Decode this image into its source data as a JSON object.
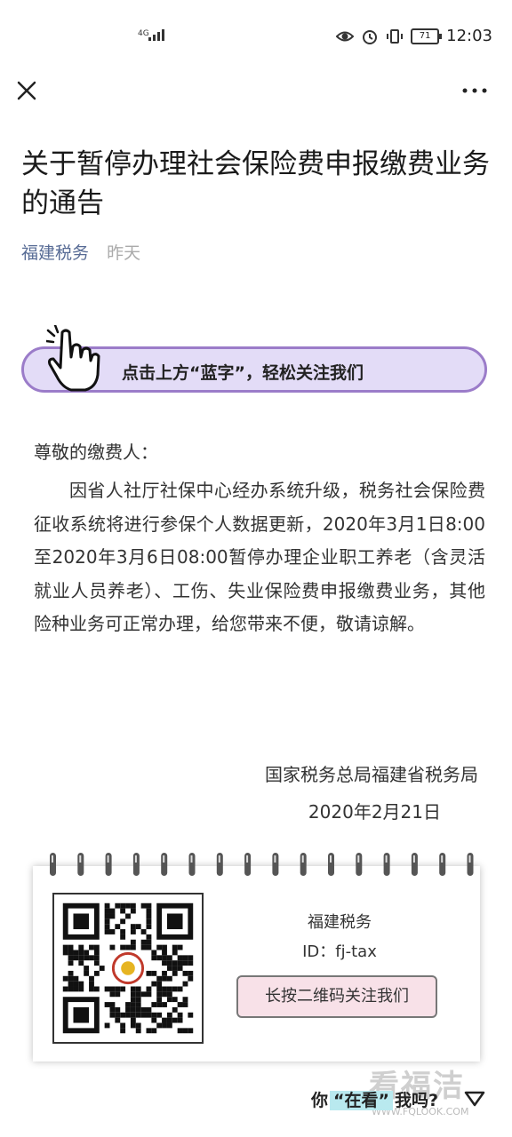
{
  "status_bar": {
    "network": "4G",
    "battery": "71",
    "time": "12:03"
  },
  "article": {
    "title": "关于暂停办理社会保险费申报缴费业务的通告",
    "account": "福建税务",
    "date": "昨天",
    "banner": "点击上方“蓝字”，轻松关注我们",
    "greeting": "尊敬的缴费人：",
    "body": "因省人社厅社保中心经办系统升级，税务社会保险费征收系统将进行参保个人数据更新，2020年3月1日8:00至2020年3月6日08:00暂停办理企业职工养老（含灵活就业人员养老）、工伤、失业保险费申报缴费业务，其他险种业务可正常办理，给您带来不便，敬请谅解。",
    "signer": "国家税务总局福建省税务局",
    "sign_date": "2020年2月21日"
  },
  "qr_card": {
    "name": "福建税务",
    "id": "ID：fj-tax",
    "button": "长按二维码关注我们"
  },
  "footer": {
    "prefix": "你",
    "highlight": "“在看”",
    "suffix": "我吗?",
    "watermark": "看福洁",
    "watermark_url": "WWW.FQLOOK.COM"
  },
  "colors": {
    "account_link": "#576b95",
    "banner_bg": "#e3dcf7",
    "banner_border": "#9b7cc9",
    "button_bg": "#f8e1e8",
    "highlight_bg": "#b9e9ef"
  },
  "icons": [
    "signal-icon",
    "eye-icon",
    "alarm-icon",
    "vibrate-icon",
    "battery-icon",
    "close-icon",
    "more-icon",
    "hand-pointer-icon",
    "qr-code",
    "chevron-down-icon"
  ]
}
